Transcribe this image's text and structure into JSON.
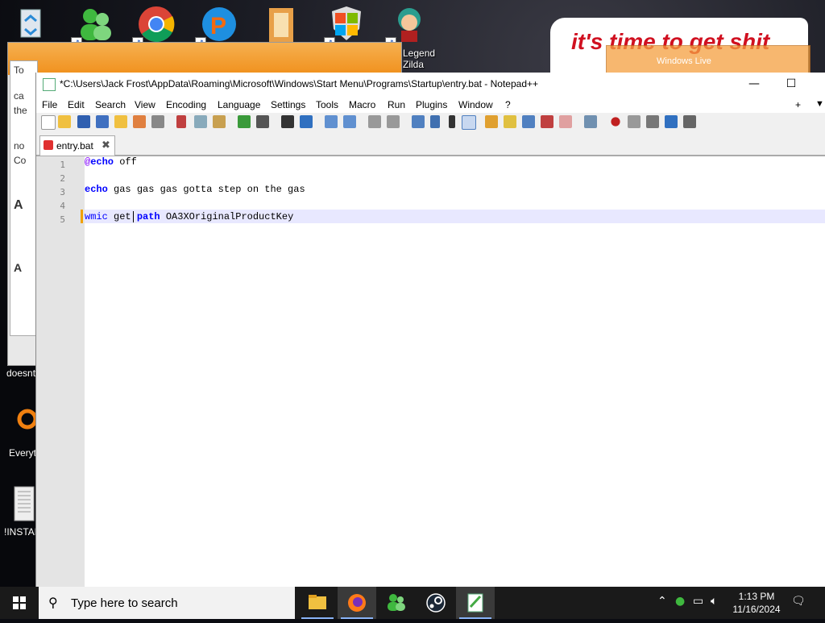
{
  "desktop": {
    "icons": [
      {
        "name": "recycle-bin-icon",
        "label": ""
      },
      {
        "name": "windows-live-messenger-icon",
        "label": ""
      },
      {
        "name": "chrome-icon",
        "label": ""
      },
      {
        "name": "paint-icon",
        "label": ""
      },
      {
        "name": "document-icon",
        "label": ""
      },
      {
        "name": "windows-shield-icon",
        "label": ""
      },
      {
        "name": "legend-zilda-icon",
        "label": "Legend\nZilda"
      }
    ],
    "left_labels": {
      "doesnt": "doesnt",
      "everything": "Everyt",
      "install": "!INSTAL"
    },
    "banner_text": "it's time to get shit",
    "wl_small_title": "Windows Live",
    "wl_side_texts": [
      "To",
      "ca",
      "the",
      "no",
      "Co",
      "A",
      "A"
    ]
  },
  "notepad": {
    "title": "*C:\\Users\\Jack Frost\\AppData\\Roaming\\Microsoft\\Windows\\Start Menu\\Programs\\Startup\\entry.bat - Notepad++",
    "menu": [
      "File",
      "Edit",
      "Search",
      "View",
      "Encoding",
      "Language",
      "Settings",
      "Tools",
      "Macro",
      "Run",
      "Plugins",
      "Window",
      "?"
    ],
    "menu_right": [
      "+",
      "▼"
    ],
    "tab_label": "entry.bat",
    "line_numbers": [
      "1",
      "2",
      "3",
      "4",
      "5"
    ],
    "lines": {
      "l1_at": "@",
      "l1_kw": "echo",
      "l1_rest": " off",
      "l3_kw": "echo",
      "l3_rest": " gas gas gas gotta step on the gas",
      "l5_wmic": "wmic",
      "l5_get": " get ",
      "l5_kw": "path",
      "l5_rest": " OA3XOriginalProductKey"
    }
  },
  "taskbar": {
    "search_placeholder": "Type here to search",
    "time": "1:13 PM",
    "date": "11/16/2024",
    "apps": [
      "file-explorer-icon",
      "firefox-icon",
      "messenger-icon",
      "steam-icon",
      "notepadpp-icon"
    ]
  }
}
